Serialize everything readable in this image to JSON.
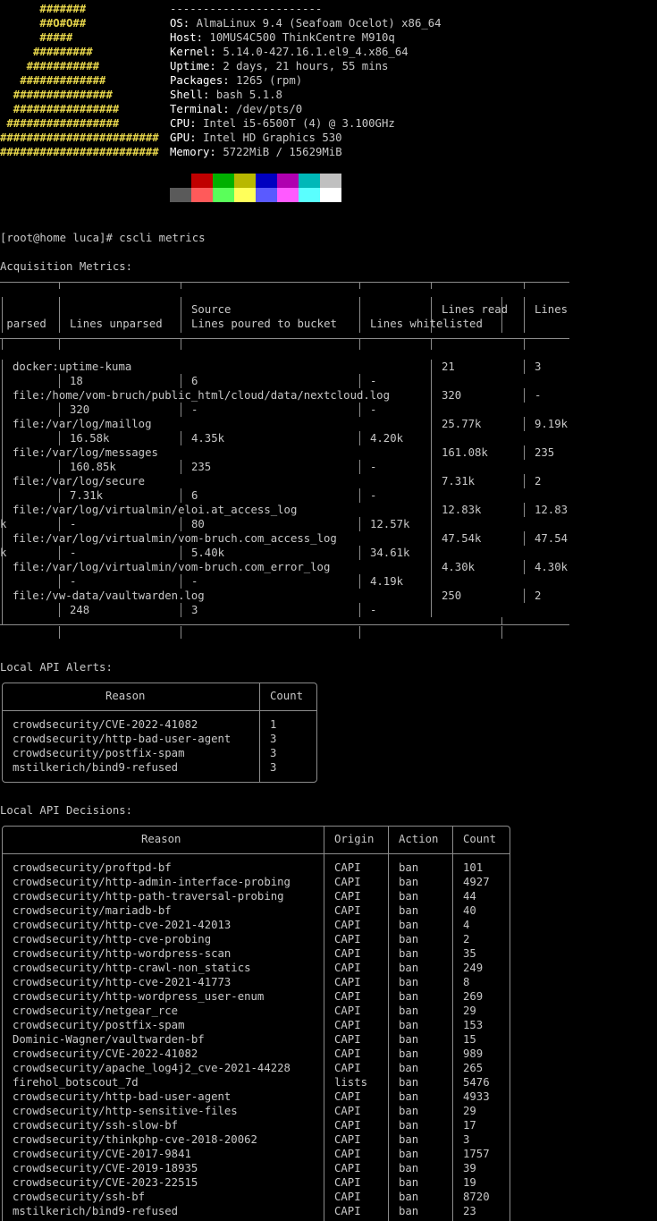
{
  "terminal": {
    "logo": [
      "      #######",
      "      ##O#O##",
      "      #####",
      "     #########",
      "    ###########",
      "   #############",
      "  ###############",
      "  ################",
      " #################",
      "########################",
      "########################",
      "  ##############"
    ],
    "logo_color": "#e5d44a",
    "system_info": {
      "separator": "-----------------------",
      "rows": [
        {
          "key": "OS:",
          "value": " AlmaLinux 9.4 (Seafoam Ocelot) x86_64"
        },
        {
          "key": "Host:",
          "value": " 10MUS4C500 ThinkCentre M910q"
        },
        {
          "key": "Kernel:",
          "value": " 5.14.0-427.16.1.el9_4.x86_64"
        },
        {
          "key": "Uptime:",
          "value": " 2 days, 21 hours, 55 mins"
        },
        {
          "key": "Packages:",
          "value": " 1265 (rpm)"
        },
        {
          "key": "Shell:",
          "value": " bash 5.1.8"
        },
        {
          "key": "Terminal:",
          "value": " /dev/pts/0"
        },
        {
          "key": "CPU:",
          "value": " Intel i5-6500T (4) @ 3.100GHz"
        },
        {
          "key": "GPU:",
          "value": " Intel HD Graphics 530"
        },
        {
          "key": "Memory:",
          "value": " 5722MiB / 15629MiB"
        }
      ]
    },
    "palette": {
      "normal": [
        "#000000",
        "#c00000",
        "#00b000",
        "#b8b800",
        "#0000c0",
        "#b000b0",
        "#00b8b8",
        "#c0c0c0"
      ],
      "bright": [
        "#5a5a5a",
        "#ff5a5a",
        "#5aff5a",
        "#ffff5a",
        "#5a5aff",
        "#ff5aff",
        "#5affff",
        "#ffffff"
      ]
    },
    "prompt": "[root@home luca]# cscli metrics",
    "acquisition": {
      "title": "Acquisition Metrics:",
      "header_line1": {
        "source": "Source",
        "lines_read": "Lines read",
        "lines_trunc": "Lines"
      },
      "header_line2": {
        "parsed": " parsed",
        "unparsed": "Lines unparsed",
        "poured": "Lines poured to bucket",
        "whitelisted": "Lines whitelisted"
      },
      "rows": [
        {
          "source": "docker:uptime-kuma",
          "read": "21",
          "parsed": "3",
          "wrap": "",
          "unparsed": "18",
          "poured": "6",
          "whitelisted": "-"
        },
        {
          "source": "file:/home/vom-bruch/public_html/cloud/data/nextcloud.log",
          "read": "320",
          "parsed": "-",
          "wrap": "",
          "unparsed": "320",
          "poured": "-",
          "whitelisted": "-"
        },
        {
          "source": "file:/var/log/maillog",
          "read": "25.77k",
          "parsed": "9.19k",
          "wrap": "",
          "unparsed": "16.58k",
          "poured": "4.35k",
          "whitelisted": "4.20k"
        },
        {
          "source": "file:/var/log/messages",
          "read": "161.08k",
          "parsed": "235",
          "wrap": "",
          "unparsed": "160.85k",
          "poured": "235",
          "whitelisted": "-"
        },
        {
          "source": "file:/var/log/secure",
          "read": "7.31k",
          "parsed": "2",
          "wrap": "",
          "unparsed": "7.31k",
          "poured": "6",
          "whitelisted": "-"
        },
        {
          "source": "file:/var/log/virtualmin/eloi.at_access_log",
          "read": "12.83k",
          "parsed": "12.83",
          "wrap": "k",
          "unparsed": "-",
          "poured": "80",
          "whitelisted": "12.57k"
        },
        {
          "source": "file:/var/log/virtualmin/vom-bruch.com_access_log",
          "read": "47.54k",
          "parsed": "47.54",
          "wrap": "k",
          "unparsed": "-",
          "poured": "5.40k",
          "whitelisted": "34.61k"
        },
        {
          "source": "file:/var/log/virtualmin/vom-bruch.com_error_log",
          "read": "4.30k",
          "parsed": "4.30k",
          "wrap": "",
          "unparsed": "-",
          "poured": "-",
          "whitelisted": "4.19k"
        },
        {
          "source": "file:/vw-data/vaultwarden.log",
          "read": "250",
          "parsed": "2",
          "wrap": "",
          "unparsed": "248",
          "poured": "3",
          "whitelisted": "-"
        }
      ]
    },
    "alerts": {
      "title": "Local API Alerts:",
      "headers": {
        "reason": "Reason",
        "count": "Count"
      },
      "rows": [
        {
          "reason": "crowdsecurity/CVE-2022-41082",
          "count": "1"
        },
        {
          "reason": "crowdsecurity/http-bad-user-agent",
          "count": "3"
        },
        {
          "reason": "crowdsecurity/postfix-spam",
          "count": "3"
        },
        {
          "reason": "mstilkerich/bind9-refused",
          "count": "3"
        }
      ]
    },
    "decisions": {
      "title": "Local API Decisions:",
      "headers": {
        "reason": "Reason",
        "origin": "Origin",
        "action": "Action",
        "count": "Count"
      },
      "rows": [
        {
          "reason": "crowdsecurity/proftpd-bf",
          "origin": "CAPI",
          "action": "ban",
          "count": "101"
        },
        {
          "reason": "crowdsecurity/http-admin-interface-probing",
          "origin": "CAPI",
          "action": "ban",
          "count": "4927"
        },
        {
          "reason": "crowdsecurity/http-path-traversal-probing",
          "origin": "CAPI",
          "action": "ban",
          "count": "44"
        },
        {
          "reason": "crowdsecurity/mariadb-bf",
          "origin": "CAPI",
          "action": "ban",
          "count": "40"
        },
        {
          "reason": "crowdsecurity/http-cve-2021-42013",
          "origin": "CAPI",
          "action": "ban",
          "count": "4"
        },
        {
          "reason": "crowdsecurity/http-cve-probing",
          "origin": "CAPI",
          "action": "ban",
          "count": "2"
        },
        {
          "reason": "crowdsecurity/http-wordpress-scan",
          "origin": "CAPI",
          "action": "ban",
          "count": "35"
        },
        {
          "reason": "crowdsecurity/http-crawl-non_statics",
          "origin": "CAPI",
          "action": "ban",
          "count": "249"
        },
        {
          "reason": "crowdsecurity/http-cve-2021-41773",
          "origin": "CAPI",
          "action": "ban",
          "count": "8"
        },
        {
          "reason": "crowdsecurity/http-wordpress_user-enum",
          "origin": "CAPI",
          "action": "ban",
          "count": "269"
        },
        {
          "reason": "crowdsecurity/netgear_rce",
          "origin": "CAPI",
          "action": "ban",
          "count": "29"
        },
        {
          "reason": "crowdsecurity/postfix-spam",
          "origin": "CAPI",
          "action": "ban",
          "count": "153"
        },
        {
          "reason": "Dominic-Wagner/vaultwarden-bf",
          "origin": "CAPI",
          "action": "ban",
          "count": "15"
        },
        {
          "reason": "crowdsecurity/CVE-2022-41082",
          "origin": "CAPI",
          "action": "ban",
          "count": "989"
        },
        {
          "reason": "crowdsecurity/apache_log4j2_cve-2021-44228",
          "origin": "CAPI",
          "action": "ban",
          "count": "265"
        },
        {
          "reason": "firehol_botscout_7d",
          "origin": "lists",
          "action": "ban",
          "count": "5476"
        },
        {
          "reason": "crowdsecurity/http-bad-user-agent",
          "origin": "CAPI",
          "action": "ban",
          "count": "4933"
        },
        {
          "reason": "crowdsecurity/http-sensitive-files",
          "origin": "CAPI",
          "action": "ban",
          "count": "29"
        },
        {
          "reason": "crowdsecurity/ssh-slow-bf",
          "origin": "CAPI",
          "action": "ban",
          "count": "17"
        },
        {
          "reason": "crowdsecurity/thinkphp-cve-2018-20062",
          "origin": "CAPI",
          "action": "ban",
          "count": "3"
        },
        {
          "reason": "crowdsecurity/CVE-2017-9841",
          "origin": "CAPI",
          "action": "ban",
          "count": "1757"
        },
        {
          "reason": "crowdsecurity/CVE-2019-18935",
          "origin": "CAPI",
          "action": "ban",
          "count": "39"
        },
        {
          "reason": "crowdsecurity/CVE-2023-22515",
          "origin": "CAPI",
          "action": "ban",
          "count": "19"
        },
        {
          "reason": "crowdsecurity/ssh-bf",
          "origin": "CAPI",
          "action": "ban",
          "count": "8720"
        },
        {
          "reason": "mstilkerich/bind9-refused",
          "origin": "CAPI",
          "action": "ban",
          "count": "23"
        }
      ]
    }
  }
}
